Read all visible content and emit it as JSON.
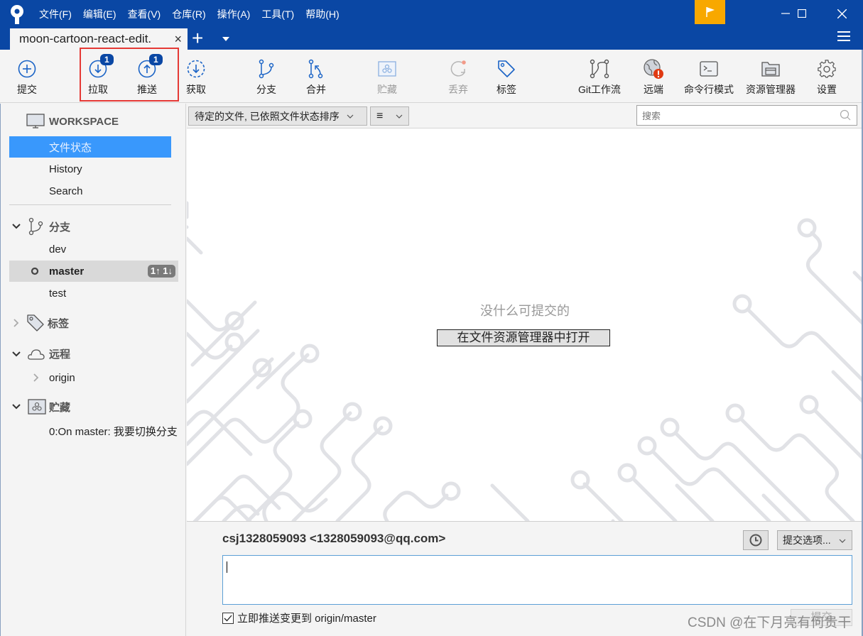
{
  "app": {
    "menu": [
      "文件(F)",
      "编辑(E)",
      "查看(V)",
      "仓库(R)",
      "操作(A)",
      "工具(T)",
      "帮助(H)"
    ],
    "tab": {
      "label": "moon-cartoon-react-edit",
      "close": "×"
    },
    "new_tab": "+"
  },
  "toolbar": {
    "commit": "提交",
    "pull": "拉取",
    "pull_badge": "1",
    "push": "推送",
    "push_badge": "1",
    "fetch": "获取",
    "branch": "分支",
    "merge": "合并",
    "stash": "贮藏",
    "discard": "丢弃",
    "tag": "标签",
    "gitflow": "Git工作流",
    "remote": "远端",
    "terminal": "命令行模式",
    "explorer": "资源管理器",
    "settings": "设置"
  },
  "sidebar": {
    "workspace": {
      "title": "WORKSPACE",
      "items": [
        "文件状态",
        "History",
        "Search"
      ]
    },
    "branches": {
      "title": "分支",
      "items": [
        "dev",
        "master",
        "test"
      ],
      "current": "master",
      "ahead_behind": "1↑ 1↓"
    },
    "tags": {
      "title": "标签"
    },
    "remotes": {
      "title": "远程",
      "items": [
        "origin"
      ]
    },
    "stashes": {
      "title": "贮藏",
      "items": [
        "0:On master: 我要切换分支"
      ]
    }
  },
  "main": {
    "sort_select": "待定的文件, 已依照文件状态排序",
    "view_select": "≡",
    "search_placeholder": "搜索",
    "empty_message": "没什么可提交的",
    "open_in_explorer": "在文件资源管理器中打开"
  },
  "commit_panel": {
    "author": "csj1328059093 <1328059093@qq.com>",
    "options": "提交选项...",
    "message": "",
    "push_checkbox_label": "立即推送变更到 origin/master",
    "push_checked": true,
    "commit_button": "提交"
  },
  "watermark": "CSDN @在下月亮有何贵干",
  "colors": {
    "titlebar": "#0a47a4",
    "accent": "#1a63c6",
    "selection": "#3998fc",
    "flag": "#f8a800",
    "alert": "#e03a12"
  }
}
